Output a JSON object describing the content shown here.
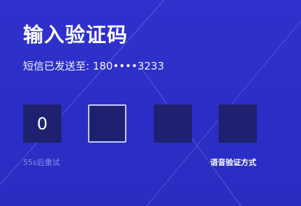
{
  "page": {
    "title": "输入验证码",
    "subtitle": "短信已发送至: 180••••3233"
  },
  "code": {
    "digits": [
      "0",
      "",
      "",
      ""
    ],
    "active_index": 1
  },
  "actions": {
    "resend_countdown": "55s后重试",
    "voice_code": "语音验证方式"
  },
  "colors": {
    "background": "#2c2fc8",
    "box_fill": "#1f2170",
    "active_border": "#c9cbff",
    "muted_text": "#8b8fe6"
  }
}
